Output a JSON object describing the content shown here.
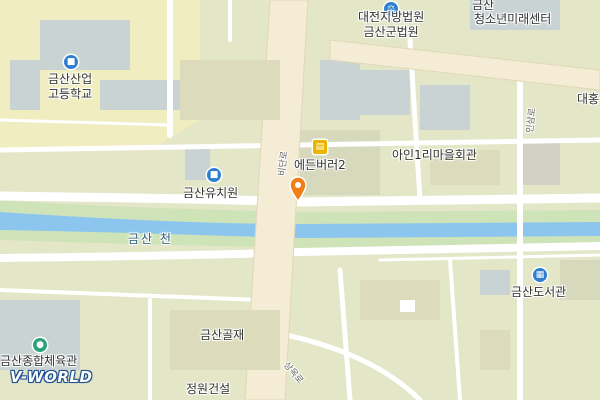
{
  "map": {
    "colors": {
      "land": "#e4e6c8",
      "block": "#dcdcbc",
      "road": "#ffffff",
      "arterial": "#f4ecd4",
      "river": "#8cc6ee",
      "river_bank": "#cfe3b8",
      "building": "#c9d3d3",
      "school": "#f0eec0",
      "marker": "#f07f1a"
    },
    "labels": {
      "court": "대전지방법원\n금산군법원",
      "geumsan_top": "금산",
      "youth_center": "청소년미래센터",
      "high_school": "금산산업\n고등학교",
      "kindergarten": "금산유치원",
      "edenvill": "에든버러2",
      "village_hall": "아인1리마을회관",
      "daehong": "대홍",
      "library": "금산도서관",
      "river": "금산 천",
      "geumsan_golje": "금산골재",
      "sports_hall": "금산종합체육관",
      "jeongwon": "정원건설"
    },
    "road_labels": {
      "bidan": "비단로",
      "ingsam": "인삼로",
      "sangok": "상옥로"
    },
    "icons": {
      "court": "court-icon",
      "high_school": "school-icon",
      "kindergarten": "school-icon",
      "edenvill": "building-icon",
      "library": "library-icon",
      "sports_hall": "sports-icon",
      "marker": "location-pin-icon"
    },
    "watermark": "V-WORLD"
  }
}
